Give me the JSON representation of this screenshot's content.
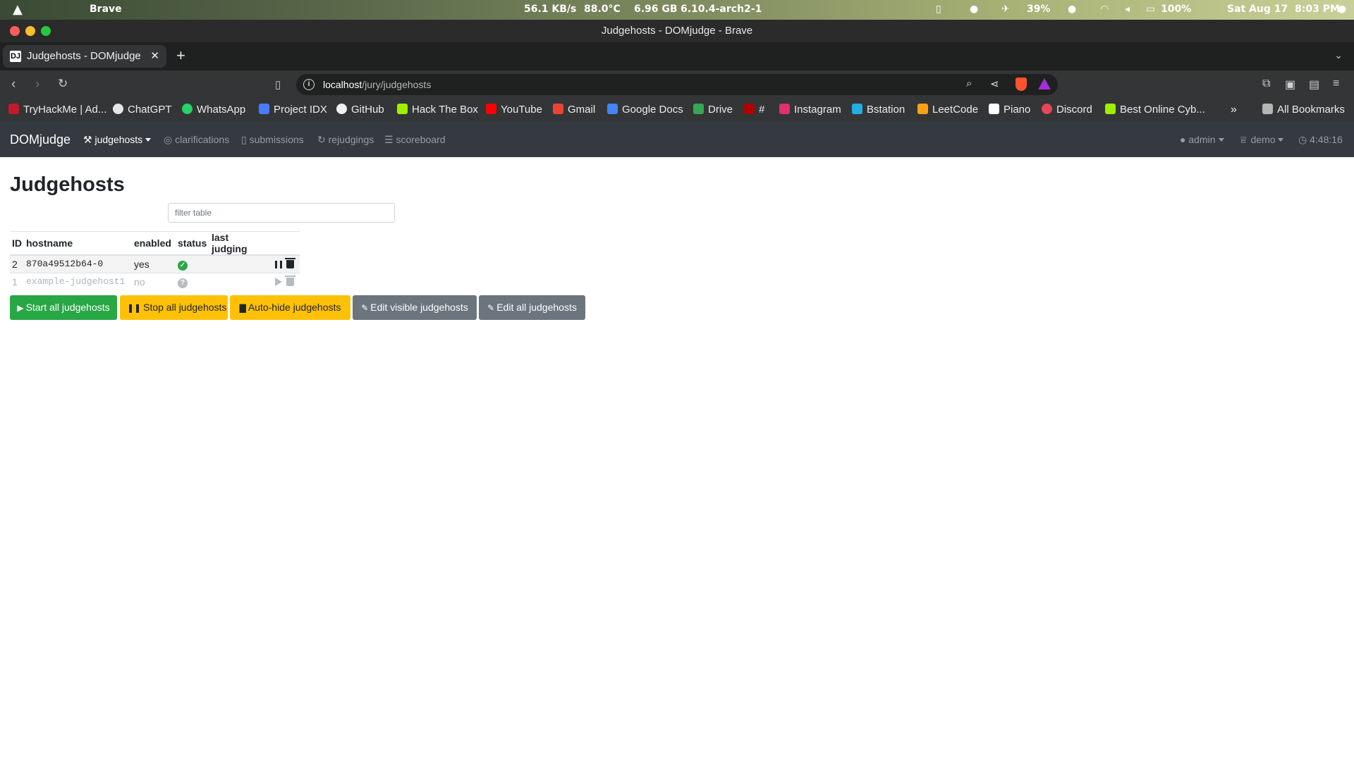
{
  "system_bar": {
    "app": "Brave",
    "net_speed": "56.1 KB/s",
    "temp": "88.0°C",
    "mem": "6.96 GB",
    "kernel": "6.10.4-arch2-1",
    "mouse_battery": "39%",
    "battery": "100%",
    "datetime": "Sat Aug 17  8:03 PM"
  },
  "window": {
    "title": "Judgehosts - DOMjudge - Brave"
  },
  "tab": {
    "title": "Judgehosts - DOMjudge",
    "favicon": "DJ",
    "close": "✕",
    "new_tab": "+"
  },
  "address_bar": {
    "host": "localhost",
    "path": "/jury/judgehosts"
  },
  "bookmarks": [
    {
      "label": "TryHackMe | Ad...",
      "color": "#c11b2a"
    },
    {
      "label": "ChatGPT",
      "color": "#e6e6e6"
    },
    {
      "label": "WhatsApp",
      "color": "#25d366"
    },
    {
      "label": "Project IDX",
      "color": "#4a7bff"
    },
    {
      "label": "GitHub",
      "color": "#f0f0f0"
    },
    {
      "label": "Hack The Box",
      "color": "#9fef00"
    },
    {
      "label": "YouTube",
      "color": "#ff0000"
    },
    {
      "label": "Gmail",
      "color": "#ea4335"
    },
    {
      "label": "Google Docs",
      "color": "#4285f4"
    },
    {
      "label": "Drive",
      "color": "#34a853"
    },
    {
      "label": "#",
      "color": "#b30000"
    },
    {
      "label": "Instagram",
      "color": "#e1306c"
    },
    {
      "label": "Bstation",
      "color": "#23ade5"
    },
    {
      "label": "LeetCode",
      "color": "#ffa116"
    },
    {
      "label": "Piano",
      "color": "#ffffff"
    },
    {
      "label": "Discord",
      "color": "#e8455a"
    },
    {
      "label": "Best Online Cyb...",
      "color": "#9fef00"
    }
  ],
  "bookmarks_more": "»",
  "all_bookmarks": "All Bookmarks",
  "nav": {
    "brand": "DOMjudge",
    "items": [
      "judgehosts",
      "clarifications",
      "submissions",
      "rejudgings",
      "scoreboard"
    ],
    "user": "admin",
    "contest": "demo",
    "clock": "4:48:16"
  },
  "page": {
    "title": "Judgehosts",
    "filter_placeholder": "filter table"
  },
  "table": {
    "headers": [
      "ID",
      "hostname",
      "enabled",
      "status",
      "last judging"
    ],
    "rows": [
      {
        "id": "2",
        "hostname": "870a49512b64-0",
        "enabled": "yes",
        "status": "ok",
        "last_judging": ""
      },
      {
        "id": "1",
        "hostname": "example-judgehost1",
        "enabled": "no",
        "status": "unknown",
        "last_judging": ""
      }
    ]
  },
  "buttons": {
    "start_all": "Start all judgehosts",
    "stop_all": "Stop all judgehosts",
    "auto_hide": "Auto-hide judgehosts",
    "edit_visible": "Edit visible judgehosts",
    "edit_all": "Edit all judgehosts"
  },
  "colors": {
    "success": "#28a745",
    "warning": "#ffc107",
    "secondary": "#6c757d",
    "navbar": "#343a40"
  }
}
